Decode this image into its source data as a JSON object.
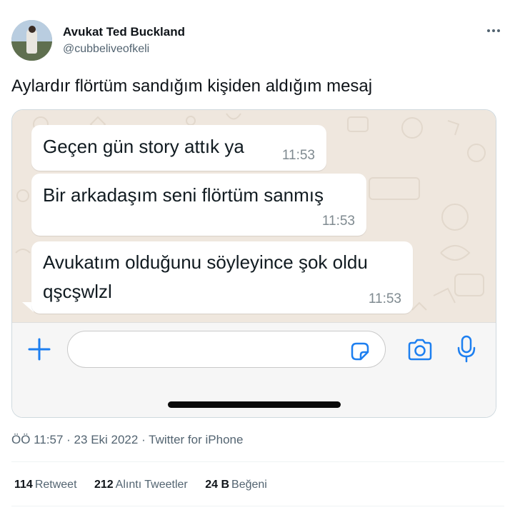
{
  "author": {
    "name": "Avukat Ted Buckland",
    "handle": "@cubbeliveofkeli"
  },
  "tweet": {
    "text": "Aylardır flörtüm sandığım kişiden aldığım mesaj",
    "timestamp": "ÖÖ 11:57 · 23 Eki 2022 · Twitter for iPhone"
  },
  "chat": {
    "messages": [
      {
        "lines": [
          "Geçen gün story attık ya"
        ],
        "time": "11:53"
      },
      {
        "lines": [
          "Bir arkadaşım seni flörtüm sanmış"
        ],
        "time": "11:53"
      },
      {
        "lines": [
          "Avukatım olduğunu söyleyince şok oldu",
          "qşcşwlzl"
        ],
        "time": "11:53"
      }
    ],
    "input_placeholder": ""
  },
  "stats": {
    "retweets_count": "114",
    "retweets_label": "Retweet",
    "quotes_count": "212",
    "quotes_label": "Alıntı Tweetler",
    "likes_count": "24 B",
    "likes_label": "Beğeni"
  },
  "icons": {
    "more": "more-horizontal-icon",
    "plus": "plus-icon",
    "sticker": "sticker-icon",
    "camera": "camera-icon",
    "mic": "microphone-icon"
  },
  "colors": {
    "accent": "#1d7ff0",
    "chat_background": "#efe7de",
    "bubble": "#ffffff"
  }
}
